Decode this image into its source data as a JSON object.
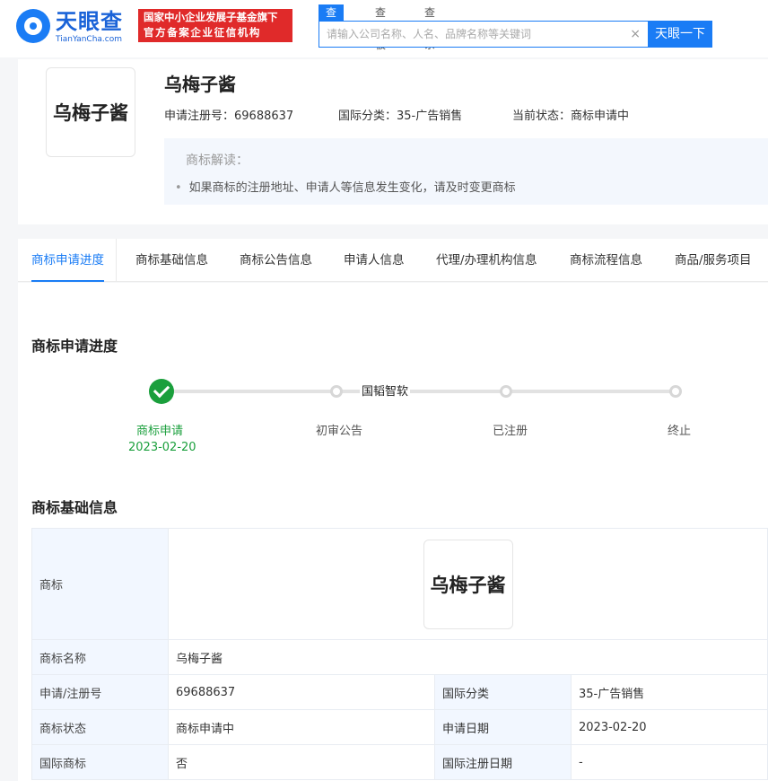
{
  "header": {
    "logo_cn": "天眼查",
    "logo_en": "TianYanCha.com",
    "gov_badge_line1": "国家中小企业发展子基金旗下",
    "gov_badge_line2": "官方备案企业征信机构",
    "search_tabs": [
      "查公司",
      "查老板",
      "查关系"
    ],
    "search_placeholder": "请输入公司名称、人名、品牌名称等关键词",
    "search_button": "天眼一下",
    "clear_icon": "×"
  },
  "trademark": {
    "image_text": "乌梅子酱",
    "title": "乌梅子酱",
    "reg_no_label": "申请注册号：",
    "reg_no": "69688637",
    "class_label": "国际分类：",
    "class": "35-广告销售",
    "status_label": "当前状态：",
    "status": "商标申请中",
    "interpretation_title": "商标解读：",
    "interpretation_item": "如果商标的注册地址、申请人等信息发生变化，请及时变更商标"
  },
  "tabs": [
    "商标申请进度",
    "商标基础信息",
    "商标公告信息",
    "申请人信息",
    "代理/办理机构信息",
    "商标流程信息",
    "商品/服务项目"
  ],
  "progress": {
    "title": "商标申请进度",
    "watermark": "国韬智软",
    "steps": [
      {
        "label": "商标申请",
        "date": "2023-02-20"
      },
      {
        "label": "初审公告"
      },
      {
        "label": "已注册"
      },
      {
        "label": "终止"
      }
    ]
  },
  "basic_info": {
    "title": "商标基础信息",
    "image_label": "商标",
    "rows": [
      {
        "label": "商标名称",
        "value": "乌梅子酱"
      },
      {
        "label": "申请/注册号",
        "value": "69688637",
        "label2": "国际分类",
        "value2": "35-广告销售"
      },
      {
        "label": "商标状态",
        "value": "商标申请中",
        "label2": "申请日期",
        "value2": "2023-02-20"
      },
      {
        "label": "国际商标",
        "value": "否",
        "label2": "国际注册日期",
        "value2": "-"
      }
    ]
  },
  "colors": {
    "primary": "#1a7cf5",
    "success": "#1a9f3c",
    "badge": "#e02a2a"
  }
}
